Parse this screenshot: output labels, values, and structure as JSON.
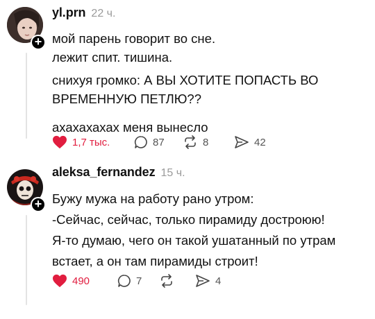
{
  "posts": [
    {
      "username": "yl.prn",
      "time": "22 ч.",
      "lines": [
        "мой парень говорит во сне.",
        "лежит спит. тишина.",
        "снихуя громко: А ВЫ ХОТИТЕ ПОПАСТЬ ВО ВРЕМЕННУЮ ПЕТЛЮ??",
        "ахахахахах меня вынесло"
      ],
      "likes": "1,7 тыс.",
      "replies": "87",
      "reposts": "8",
      "shares": "42",
      "liked": true
    },
    {
      "username": "aleksa_fernandez",
      "time": "15 ч.",
      "lines": [
        "Бужу мужа на работу рано утром:",
        "-Сейчас, сейчас, только пирамиду достроюю!",
        "Я-то думаю, чего он такой ушатанный по утрам встает, а он там пирамиды строит!"
      ],
      "likes": "490",
      "replies": "7",
      "reposts": "",
      "shares": "4",
      "liked": true
    }
  ],
  "follow_badge": "+",
  "colors": {
    "like": "#e11d3f",
    "text": "#111111",
    "muted": "#9a9a9a",
    "badge": "#000000"
  },
  "icons": [
    "heart-icon",
    "comment-icon",
    "repost-icon",
    "share-icon",
    "plus-icon"
  ]
}
